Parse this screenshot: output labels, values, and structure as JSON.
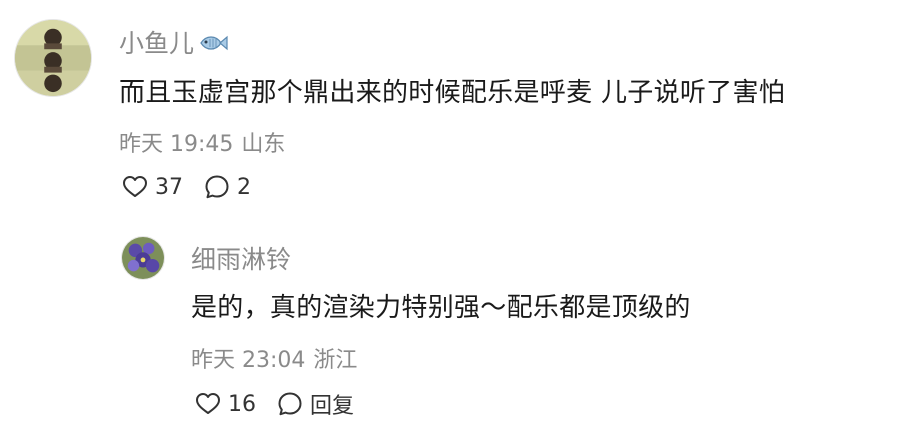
{
  "comments": [
    {
      "name": "小鱼儿",
      "name_emoji": "fish-emoji",
      "text": "而且玉虚宫那个鼎出来的时候配乐是呼麦 儿子说听了害怕",
      "time": "昨天 19:45",
      "location": "山东",
      "likes": "37",
      "replies": "2"
    },
    {
      "name": "细雨淋铃",
      "text": "是的，真的渲染力特别强～配乐都是顶级的",
      "time": "昨天 23:04",
      "location": "浙江",
      "likes": "16",
      "reply_label": "回复"
    }
  ],
  "colors": {
    "meta": "#8a8a8a",
    "text": "#1a1a1a",
    "icon": "#333333"
  }
}
